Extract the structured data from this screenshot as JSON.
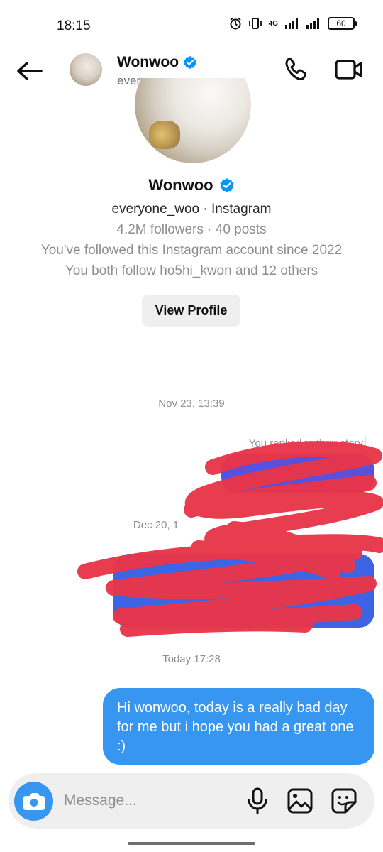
{
  "status_bar": {
    "time": "18:15",
    "network": "4G",
    "battery": "60",
    "icons": [
      "alarm-icon",
      "vibrate-icon",
      "signal-icon",
      "signal-icon",
      "battery-icon"
    ]
  },
  "header": {
    "name": "Wonwoo",
    "username": "everyone_woo",
    "icons": [
      "back-arrow-icon",
      "verified-badge-icon",
      "phone-icon",
      "video-camera-icon"
    ]
  },
  "profile": {
    "name": "Wonwoo",
    "subtitle": "everyone_woo · Instagram",
    "stats": "4.2M followers · 40 posts",
    "since": "You've followed this Instagram account since 2022",
    "mutual": "You both follow ho5hi_kwon and 12 others",
    "view_profile_label": "View Profile"
  },
  "chat": {
    "timestamps": [
      "Nov 23, 13:39",
      "Dec 20, 1",
      "Today 17:28"
    ],
    "story_reply_note": "You replied to their story",
    "last_message": "Hi wonwoo, today is a really bad day for me but i hope you had a great one :)"
  },
  "composer": {
    "placeholder": "Message...",
    "icons": [
      "camera-icon",
      "microphone-icon",
      "gallery-icon",
      "sticker-icon"
    ]
  },
  "colors": {
    "primary_blue": "#3797f0",
    "story_bubble": "#5851db",
    "scribble_red": "#e8364a",
    "verified": "#0095f6"
  }
}
